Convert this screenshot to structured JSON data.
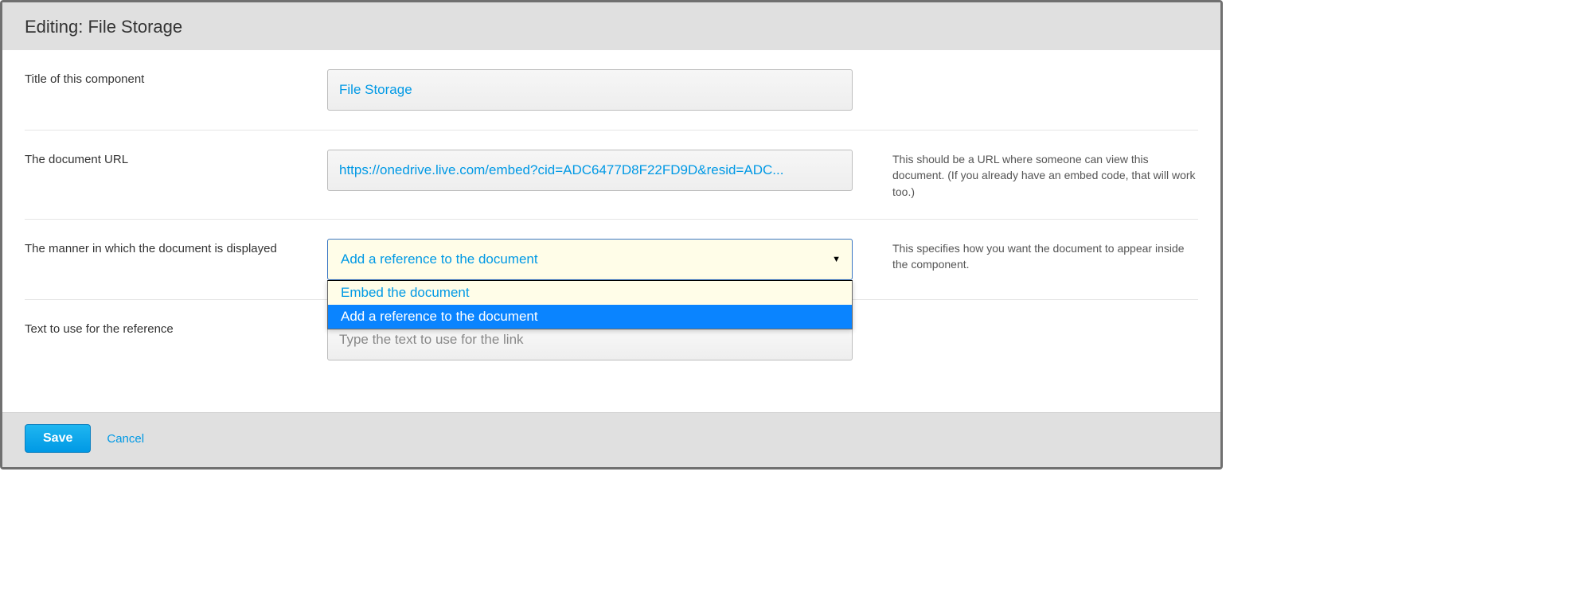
{
  "header": {
    "title": "Editing: File Storage"
  },
  "fields": {
    "title": {
      "label": "Title of this component",
      "value": "File Storage"
    },
    "url": {
      "label": "The document URL",
      "value": "https://onedrive.live.com/embed?cid=ADC6477D8F22FD9D&resid=ADC...",
      "help": "This should be a URL where someone can view this document. (If you already have an embed code, that will work too.)"
    },
    "manner": {
      "label": "The manner in which the document is displayed",
      "selected": "Add a reference to the document",
      "options": [
        "Embed the document",
        "Add a reference to the document"
      ],
      "help": "This specifies how you want the document to appear inside the component."
    },
    "ref_text": {
      "label": "Text to use for the reference",
      "placeholder": "Type the text to use for the link",
      "value": ""
    }
  },
  "footer": {
    "save": "Save",
    "cancel": "Cancel"
  }
}
